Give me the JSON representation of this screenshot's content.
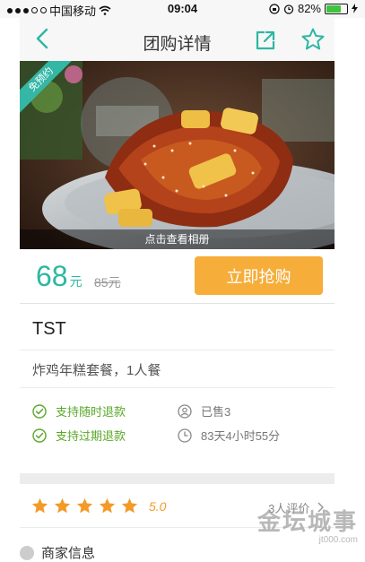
{
  "status_bar": {
    "carrier": "中国移动",
    "time": "09:04",
    "battery": "82%",
    "battery_level": 0.82
  },
  "nav": {
    "title": "团购详情",
    "icons": [
      "back-icon",
      "share-icon",
      "star-icon"
    ]
  },
  "hero": {
    "ribbon": "免预约",
    "hint": "点击查看相册"
  },
  "price": {
    "current": "68",
    "unit": "元",
    "original": "85元",
    "buy_label": "立即抢购"
  },
  "deal": {
    "title": "TST",
    "description": "炸鸡年糕套餐，1人餐"
  },
  "features": {
    "refund_anytime": "支持随时退款",
    "refund_expired": "支持过期退款",
    "sold": "已售3",
    "time_left": "83天4小时55分"
  },
  "rating": {
    "stars": 5,
    "score": "5.0",
    "reviews": "3人评价"
  },
  "merchant": {
    "label": "商家信息"
  },
  "watermark": {
    "main": "金坛城事",
    "url": "jt000.com"
  },
  "colors": {
    "accent": "#2cb7a2",
    "buy_button": "#f6ad3a",
    "star": "#f39a28",
    "check_green": "#5aa82a"
  }
}
